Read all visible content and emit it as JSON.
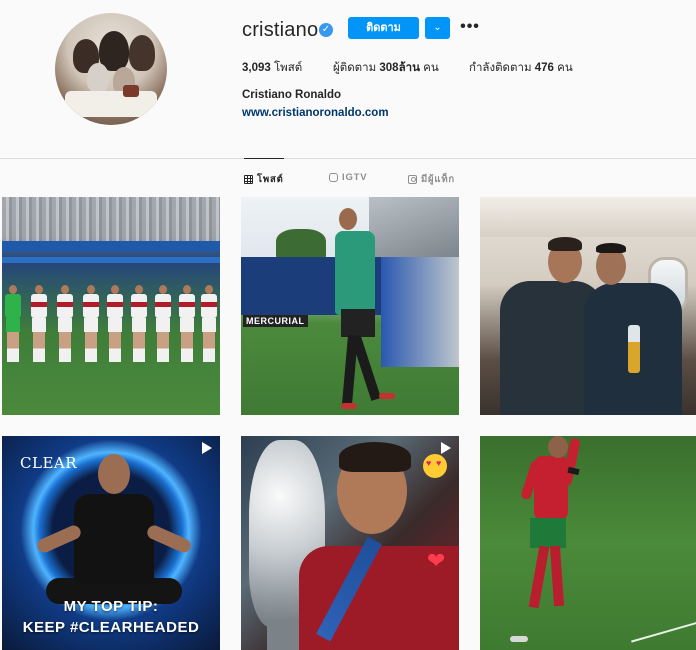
{
  "profile": {
    "username": "cristiano",
    "follow_label": "ติดตาม",
    "more_label": "•••",
    "full_name": "Cristiano Ronaldo",
    "website": "www.cristianoronaldo.com"
  },
  "stats": {
    "posts_count": "3,093",
    "posts_label": "โพสต์",
    "followers_label": "ผู้ติดตาม",
    "followers_count": "308ล้าน",
    "followers_unit": "คน",
    "following_label": "กำลังติดตาม",
    "following_count": "476",
    "following_unit": "คน"
  },
  "tabs": [
    {
      "label": "โพสต์",
      "icon": "grid-icon",
      "active": true
    },
    {
      "label": "IGTV",
      "icon": "tv-icon",
      "active": false
    },
    {
      "label": "มีผู้แท็ก",
      "icon": "tag-icon",
      "active": false
    }
  ],
  "posts": [
    {
      "label": "team-lineup",
      "video": false,
      "overlay_text": "",
      "brand": ""
    },
    {
      "label": "stadium-walk",
      "video": false,
      "overlay_text": "",
      "brand": "MERCURIAL"
    },
    {
      "label": "airplane-selfie",
      "video": false,
      "overlay_text": "",
      "brand": ""
    },
    {
      "label": "clear-ad",
      "video": true,
      "brand": "CLEAR",
      "overlay_line1": "MY TOP TIP:",
      "overlay_line2": "KEEP #CLEARHEADED"
    },
    {
      "label": "trophy-kiss",
      "video": true,
      "overlay_text": "",
      "brand": ""
    },
    {
      "label": "celebration",
      "video": false,
      "overlay_text": "",
      "brand": ""
    }
  ],
  "colors": {
    "accent": "#0095f6",
    "verified": "#3897f0",
    "link": "#00376b",
    "background": "#fafafa"
  }
}
